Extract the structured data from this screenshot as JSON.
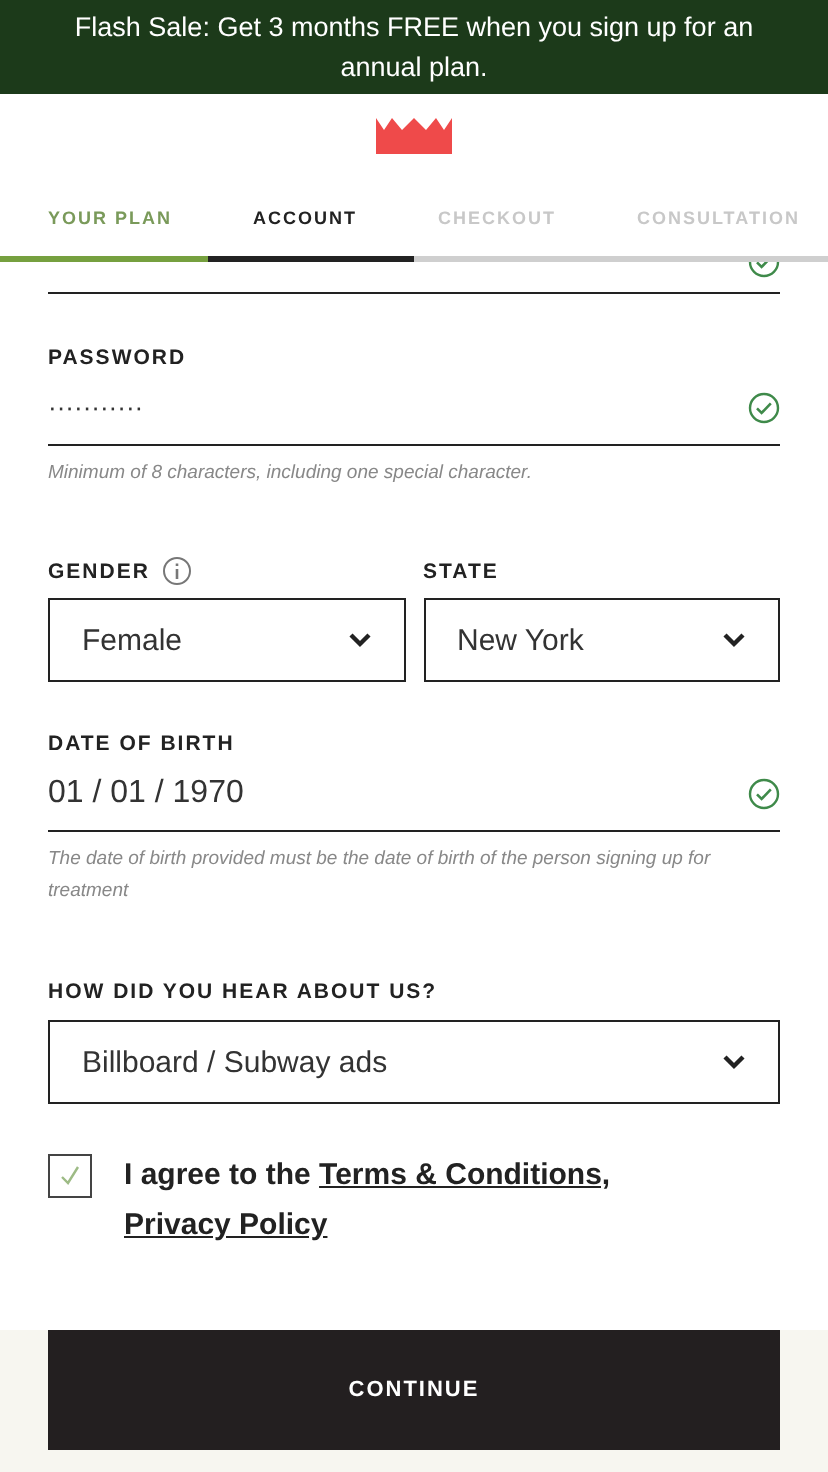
{
  "banner": {
    "text": "Flash Sale: Get 3 months FREE when you sign up for an annual plan."
  },
  "steps": [
    {
      "label": "YOUR PLAN",
      "done": true,
      "selected": false
    },
    {
      "label": "ACCOUNT",
      "done": false,
      "selected": true
    },
    {
      "label": "CHECKOUT",
      "done": false,
      "selected": false
    },
    {
      "label": "CONSULTATION",
      "done": false,
      "selected": false
    }
  ],
  "email": {
    "valid": true
  },
  "password": {
    "label": "PASSWORD",
    "value": "···········",
    "valid": true,
    "hint": "Minimum of 8 characters, including one special character."
  },
  "gender": {
    "label": "GENDER",
    "value": "Female"
  },
  "state": {
    "label": "STATE",
    "value": "New York"
  },
  "birth": {
    "label": "DATE OF BIRTH",
    "value": "01 / 01 / 1970",
    "valid": true,
    "hint": "The date of birth provided must be the date of birth of the person signing up for treatment"
  },
  "source": {
    "label": "HOW DID YOU HEAR ABOUT US?",
    "value": "Billboard / Subway ads"
  },
  "agree": {
    "checked": true,
    "text": "I agree to the",
    "terms": "Terms & Conditions,",
    "privacy": "Privacy Policy"
  },
  "continue": "CONTINUE"
}
